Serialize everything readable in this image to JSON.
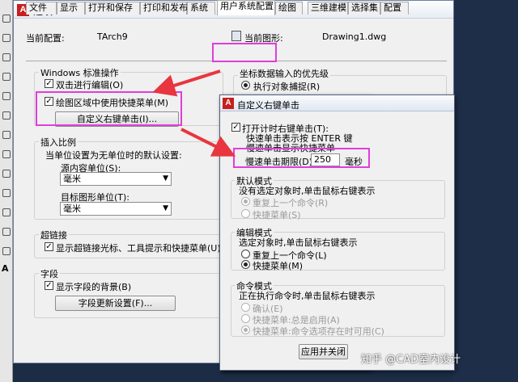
{
  "colors": {
    "highlight": "#e03ddc",
    "arrow": "#e8353f",
    "app_icon": "#c81e1e"
  },
  "icons": [
    "autocad-logo-icon",
    "drawing-file-icon",
    "check-icon",
    "dropdown-arrow-icon",
    "red-arrow"
  ],
  "window": {
    "title": "选项",
    "app_icon_letter": "A",
    "current_profile_label": "当前配置:",
    "current_profile_value": "TArch9",
    "current_drawing_label": "当前图形:",
    "current_drawing_value": "Drawing1.dwg"
  },
  "tabs": [
    {
      "label": "文件"
    },
    {
      "label": "显示"
    },
    {
      "label": "打开和保存"
    },
    {
      "label": "打印和发布"
    },
    {
      "label": "系统"
    },
    {
      "label": "用户系统配置"
    },
    {
      "label": "绘图"
    },
    {
      "label": "三维建模"
    },
    {
      "label": "选择集"
    },
    {
      "label": "配置"
    }
  ],
  "windows_ops": {
    "title": "Windows 标准操作",
    "double_click_edit": "双击进行编辑(O)",
    "shortcut_menu_drawing": "绘图区域中使用快捷菜单(M)",
    "customize_right_click_btn": "自定义右键单击(I)..."
  },
  "insert_scale": {
    "title": "插入比例",
    "desc": "当单位设置为无单位时的默认设置:",
    "source_unit_label": "源内容单位(S):",
    "source_unit_value": "毫米",
    "target_unit_label": "目标图形单位(T):",
    "target_unit_value": "毫米"
  },
  "hyperlink": {
    "title": "超链接",
    "show_label": "显示超链接光标、工具提示和快捷菜单(U)"
  },
  "fields": {
    "title": "字段",
    "show_bg": "显示字段的背景(B)",
    "update_btn": "字段更新设置(F)..."
  },
  "coord_priority": {
    "title": "坐标数据输入的优先级",
    "option1": "执行对象捕捉(R)"
  },
  "dialog": {
    "title": "自定义右键单击",
    "enable_timed": "打开计时右键单击(T):",
    "line1": "快速单击表示按 ENTER 键",
    "line2": "慢速单击显示快捷菜单",
    "long_click_label": "慢速单击期限(D):",
    "long_click_value": "250",
    "unit": "毫秒",
    "default_mode": {
      "title": "默认模式",
      "desc": "没有选定对象时,单击鼠标右键表示",
      "opt1": "重复上一个命令(R)",
      "opt2": "快捷菜单(S)"
    },
    "edit_mode": {
      "title": "编辑模式",
      "desc": "选定对象时,单击鼠标右键表示",
      "opt1": "重复上一个命令(L)",
      "opt2": "快捷菜单(M)"
    },
    "command_mode": {
      "title": "命令模式",
      "desc": "正在执行命令时,单击鼠标右键表示",
      "opt1": "确认(E)",
      "opt2": "快捷菜单:总是启用(A)",
      "opt3": "快捷菜单:命令选项存在时可用(C)"
    },
    "apply_btn": "应用并关闭"
  },
  "watermark": "知乎 @CAD室内设计"
}
